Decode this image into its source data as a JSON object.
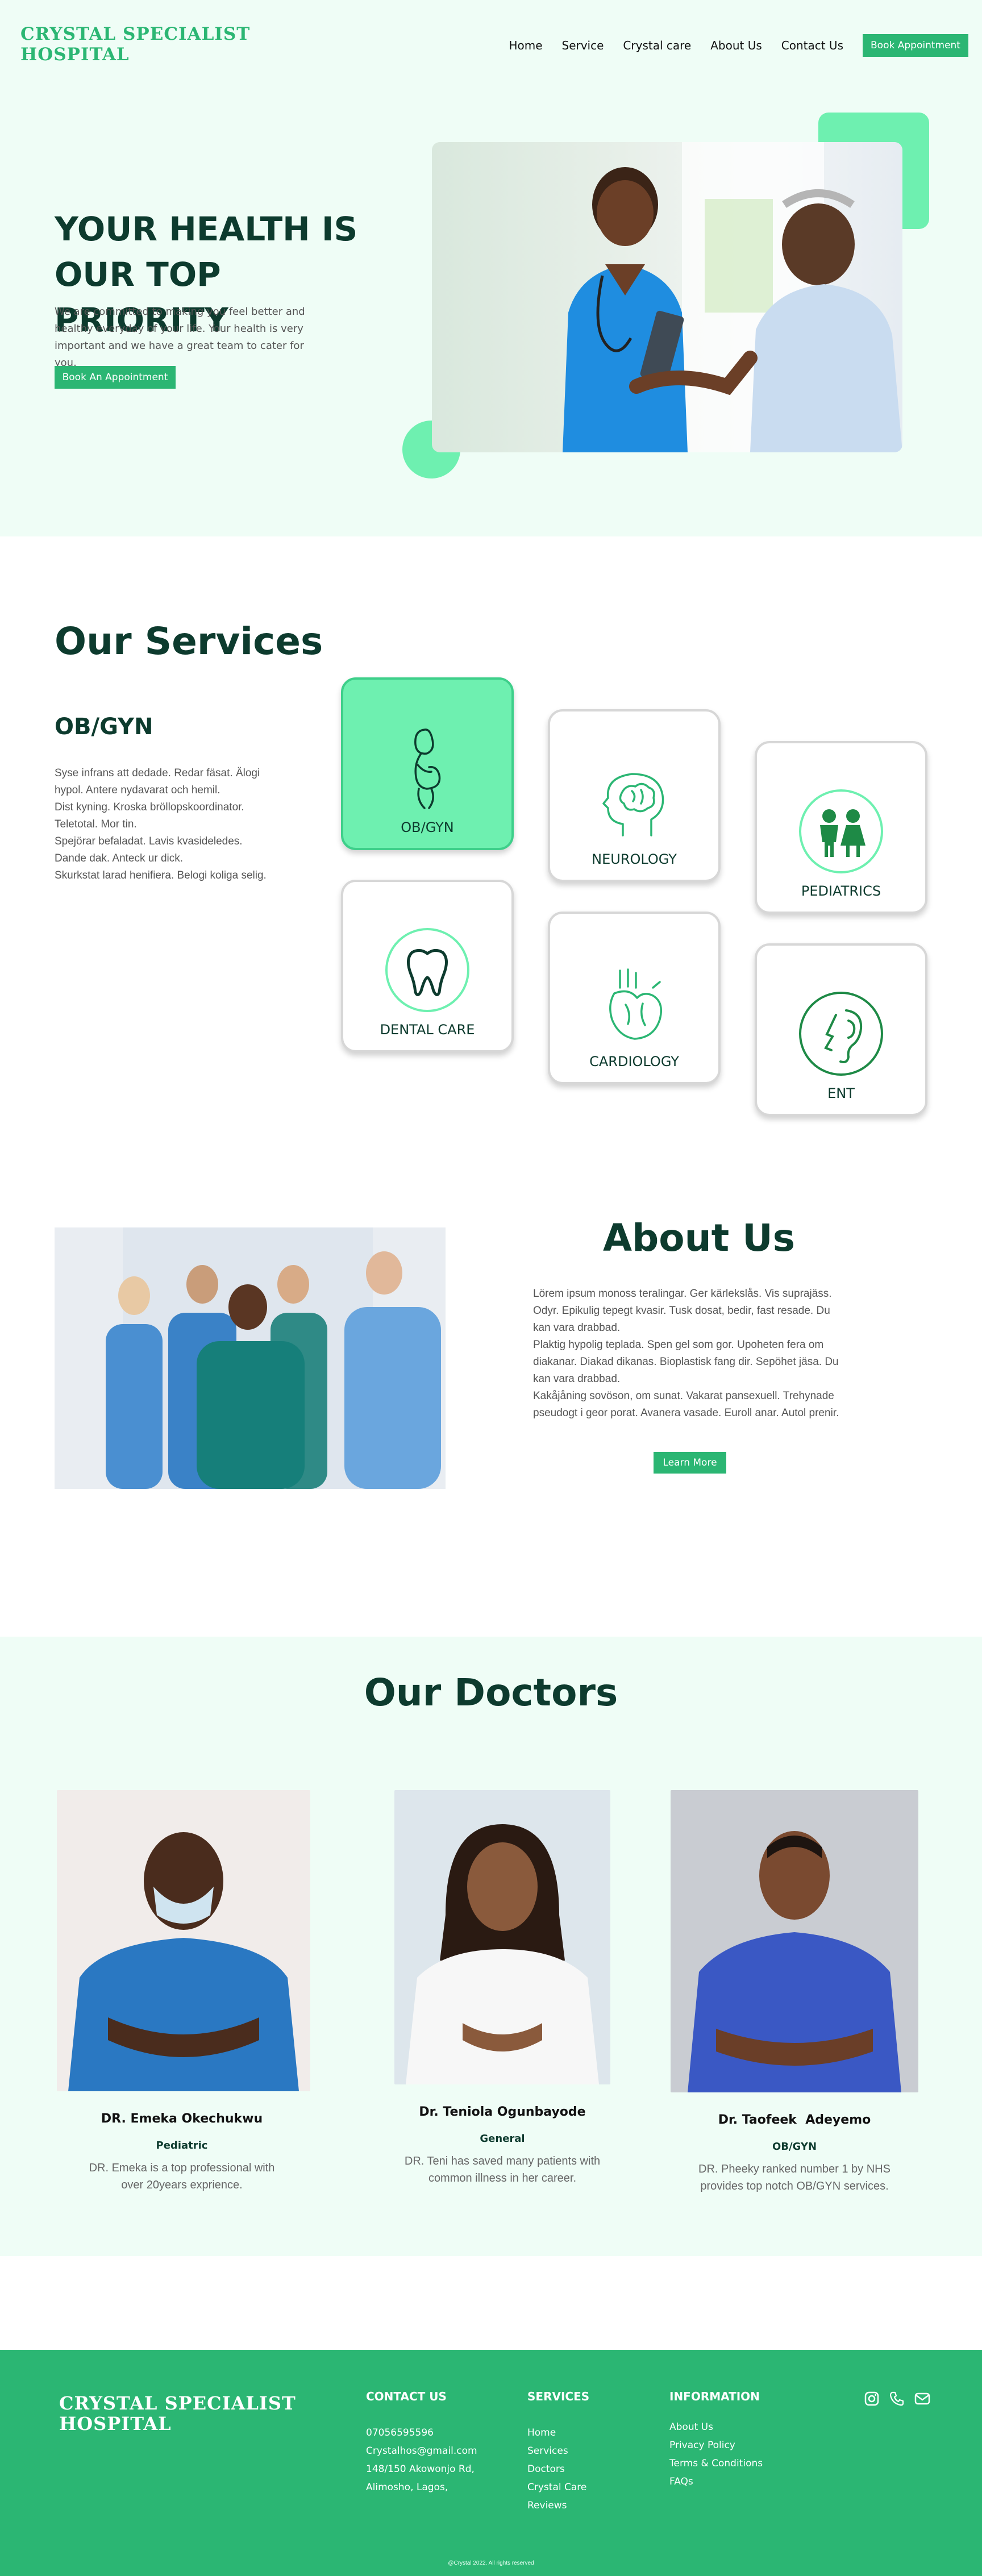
{
  "header": {
    "brand_line1": "CRYSTAL SPECIALIST",
    "brand_line2": "HOSPITAL",
    "nav": [
      "Home",
      "Service",
      "Crystal care",
      "About Us",
      "Contact Us"
    ],
    "cta": "Book Appointment"
  },
  "hero": {
    "title_line1": "YOUR HEALTH IS",
    "title_line2": "OUR TOP PRIORITY",
    "description": "We are committed to making you feel better and healthy everyday of your life. Your health is very important and we have a great team to cater for you.",
    "cta": "Book An Appointment"
  },
  "services": {
    "title": "Our Services",
    "selected": "OB/GYN",
    "text_lines": [
      "Syse infrans att dedade. Redar fäsat. Älogi",
      "hypol. Antere nydavarat och hemil.",
      "Dist kyning. Kroska bröllopskoordinator.",
      "Teletotal. Mor tin.",
      "Spejörar befaladat. Lavis kvasideledes.",
      "Dande dak. Anteck ur dick.",
      "Skurkstat larad henifiera. Belogi koliga selig."
    ],
    "cards": [
      {
        "label": "OB/GYN",
        "icon": "pregnant-icon"
      },
      {
        "label": "NEUROLOGY",
        "icon": "brain-icon"
      },
      {
        "label": "PEDIATRICS",
        "icon": "children-icon"
      },
      {
        "label": "DENTAL CARE",
        "icon": "tooth-icon"
      },
      {
        "label": "CARDIOLOGY",
        "icon": "heart-icon"
      },
      {
        "label": "ENT",
        "icon": "ear-icon"
      }
    ]
  },
  "about": {
    "title": "About Us",
    "text_lines": [
      "Lörem ipsum monoss teralingar. Ger kärlekslås. Vis suprajäss.",
      "Odyr. Epikulig tepegt kvasir. Tusk dosat, bedir, fast resade. Du",
      "kan vara drabbad.",
      "Plaktig hypolig teplada. Spen gel som gor. Upoheten fera om",
      "diakanar. Diakad dikanas. Bioplastisk fang dir. Sepöhet jäsa. Du",
      "kan vara drabbad.",
      "Kakåjåning sovöson, om sunat. Vakarat pansexuell. Trehynade",
      "pseudogt i geor porat. Avanera vasade. Euroll anar. Autol prenir."
    ],
    "cta": "Learn More"
  },
  "doctors": {
    "title": "Our Doctors",
    "items": [
      {
        "name": "DR. Emeka Okechukwu",
        "specialty": "Pediatric",
        "bio": "DR. Emeka is a top professional with over 20years exprience."
      },
      {
        "name": "Dr. Teniola Ogunbayode",
        "specialty": "General",
        "bio": "DR. Teni has saved many patients with common illness in her career."
      },
      {
        "name": "Dr. Taofeek  Adeyemo",
        "specialty": "OB/GYN",
        "bio": "DR. Pheeky ranked number 1 by NHS provides top notch OB/GYN services."
      }
    ]
  },
  "footer": {
    "brand_line1": "CRYSTAL SPECIALIST",
    "brand_line2": "HOSPITAL",
    "contact": {
      "heading": "CONTACT US",
      "items": [
        "07056595596",
        "Crystalhos@gmail.com",
        "148/150 Akowonjo Rd,",
        "Alimosho, Lagos,"
      ]
    },
    "services": {
      "heading": "SERVICES",
      "items": [
        "Home",
        "Services",
        "Doctors",
        "Crystal Care",
        "Reviews"
      ]
    },
    "information": {
      "heading": "INFORMATION",
      "items": [
        "About Us",
        "Privacy Policy",
        "Terms & Conditions",
        "FAQs"
      ]
    },
    "social_icons": [
      "instagram-icon",
      "phone-icon",
      "mail-icon"
    ],
    "copyright": "@Crystal 2022. All rights reserved"
  },
  "colors": {
    "accent": "#2bb673",
    "accent_light": "#6ef0b0",
    "bg_mint": "#effdf6",
    "heading": "#0d3b2e"
  }
}
